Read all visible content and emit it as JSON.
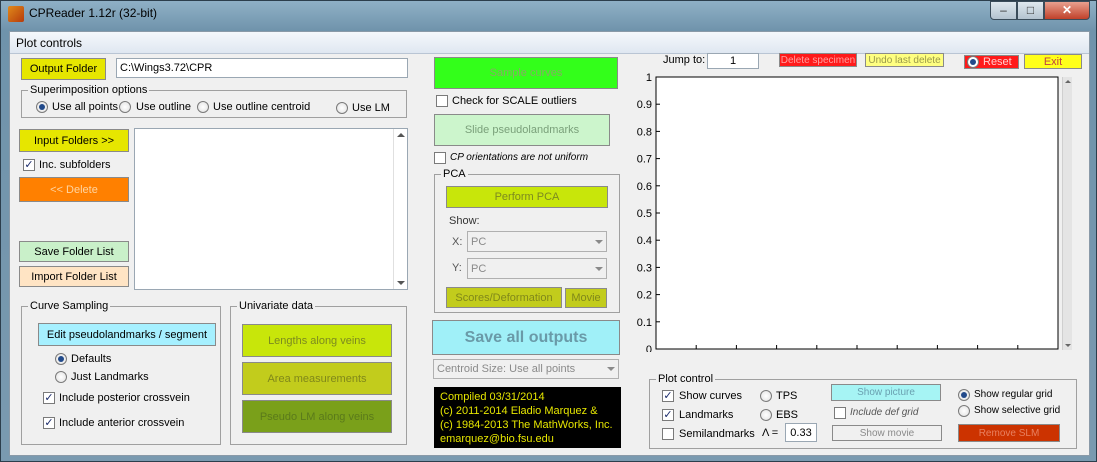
{
  "window": {
    "title": "CPReader 1.12r (32-bit)",
    "min": "–",
    "max": "□",
    "close": "✕"
  },
  "menu": {
    "label": "Plot controls"
  },
  "output": {
    "button": "Output Folder",
    "path": "C:\\Wings3.72\\CPR"
  },
  "superimposition": {
    "title": "Superimposition options",
    "options": [
      "Use all points",
      "Use outline",
      "Use outline centroid",
      "Use LM"
    ],
    "selected": 0
  },
  "folders": {
    "input_button": "Input Folders >>",
    "inc_subfolders": "Inc. subfolders",
    "delete_button": "<< Delete",
    "save_button": "Save Folder List",
    "import_button": "Import Folder List"
  },
  "curve_sampling": {
    "title": "Curve Sampling",
    "edit_button": "Edit pseudolandmarks / segment",
    "defaults": "Defaults",
    "just_landmarks": "Just Landmarks",
    "posterior": "Include posterior crossvein",
    "anterior": "Include anterior crossvein"
  },
  "univariate": {
    "title": "Univariate data",
    "lengths": "Lengths along veins",
    "area": "Area measurements",
    "pseudo": "Pseudo LM along veins"
  },
  "middle": {
    "sample_curves": "Sample curves",
    "check_scale": "Check for SCALE outliers",
    "slide": "Slide pseudolandmarks",
    "cp_orient": "CP orientations are not uniform",
    "pca_title": "PCA",
    "perform_pca": "Perform PCA",
    "show": "Show:",
    "x_label": "X:",
    "y_label": "Y:",
    "x_value": "PC",
    "y_value": "PC",
    "scores": "Scores/Deformation",
    "movie": "Movie",
    "save_all": "Save all outputs",
    "centroid": "Centroid Size: Use all points",
    "compiled": [
      "Compiled 03/31/2014",
      "(c) 2011-2014 Eladio Marquez &",
      "(c) 1984-2013 The MathWorks, Inc.",
      "emarquez@bio.fsu.edu"
    ]
  },
  "top_right": {
    "jump_label": "Jump to:",
    "jump_value": "1",
    "delete_specimen": "Delete specimen",
    "undo": "Undo last delete",
    "reset": "Reset",
    "exit": "Exit"
  },
  "chart_data": {
    "type": "scatter",
    "x": [],
    "y": [],
    "xlim": [
      0,
      1
    ],
    "ylim": [
      0,
      1
    ],
    "xticks": [
      "0",
      "0.1",
      "0.2",
      "0.3",
      "0.4",
      "0.5",
      "0.6",
      "0.7",
      "0.8",
      "0.9",
      "1"
    ],
    "yticks": [
      "0",
      "0.1",
      "0.2",
      "0.3",
      "0.4",
      "0.5",
      "0.6",
      "0.7",
      "0.8",
      "0.9",
      "1"
    ],
    "grid": false
  },
  "plot_control": {
    "title": "Plot control",
    "show_curves": "Show curves",
    "landmarks": "Landmarks",
    "semilandmarks": "Semilandmarks",
    "tps": "TPS",
    "ebs": "EBS",
    "lambda_label": "Λ =",
    "lambda_value": "0.33",
    "show_picture": "Show picture",
    "include_def_grid": "Include def grid",
    "show_movie": "Show movie",
    "regular_grid": "Show regular grid",
    "selective_grid": "Show selective grid",
    "remove_slm": "Remove SLM"
  }
}
